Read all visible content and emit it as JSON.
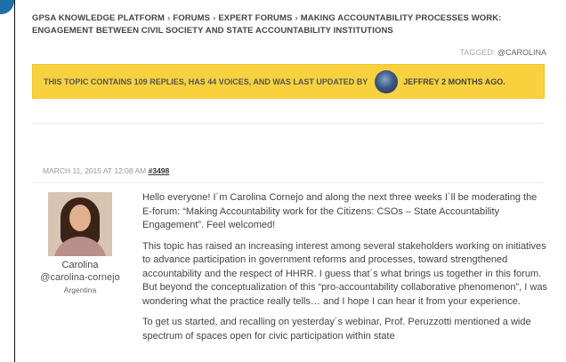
{
  "breadcrumb": {
    "items": [
      "GPSA Knowledge Platform",
      "Forums",
      "Expert Forums",
      "Making Accountability Processes Work: Engagement between Civil Society and State Accountability Institutions"
    ],
    "separator": "›"
  },
  "tags": {
    "label": "Tagged:",
    "tag": "@carolina"
  },
  "topic_notice": {
    "text": "This topic contains 109 replies, has 44 voices, and was last updated by",
    "author": "Jeffrey 2 months ago."
  },
  "post": {
    "date": "March 11, 2015 at 12:08 am",
    "permalink": "#3498",
    "author": {
      "name": "Carolina",
      "handle": "@carolina-cornejo",
      "location": "Argentina"
    },
    "paragraphs": [
      "Hello everyone! I´m Carolina Cornejo and along the next three weeks I´ll be moderating the E-forum: “Making Accountability work for the Citizens: CSOs – State Accountability Engagement”. Feel welcomed!",
      "This topic has raised an increasing interest among several stakeholders working on initiatives to advance participation in government reforms and processes, toward strengthened accountability and the respect of HHRR. I guess that´s what brings us together in this forum. But beyond the conceptualization of this “pro-accountability collaborative phenomenon”, I was wondering what the practice really tells… and I hope I can hear it from your experience.",
      "To get us started, and recalling on yesterday´s webinar, Prof. Peruzzotti mentioned a wide spectrum of spaces open for civic participation within state"
    ]
  },
  "colors": {
    "notice_bg": "#f7d23e",
    "corner_badge": "#1e6fa8"
  }
}
